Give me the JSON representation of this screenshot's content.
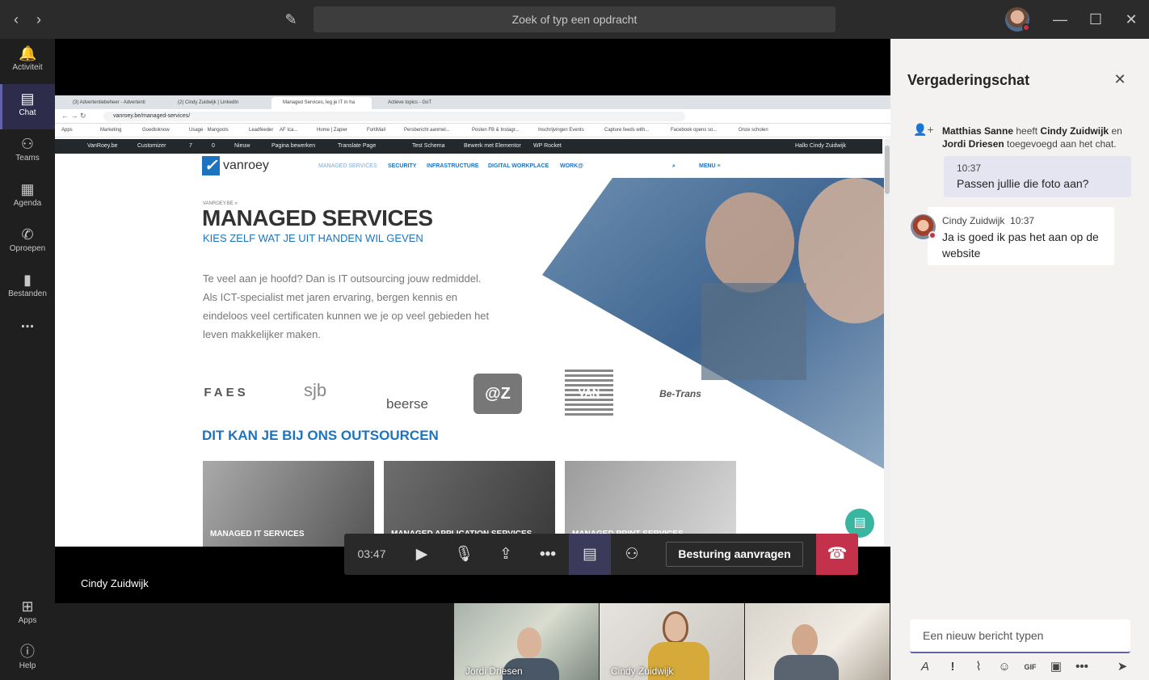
{
  "titlebar": {
    "search_placeholder": "Zoek of typ een opdracht"
  },
  "rail": {
    "items": [
      {
        "label": "Activiteit"
      },
      {
        "label": "Chat"
      },
      {
        "label": "Teams"
      },
      {
        "label": "Agenda"
      },
      {
        "label": "Oproepen"
      },
      {
        "label": "Bestanden"
      },
      {
        "label": "..."
      },
      {
        "label": "Apps"
      },
      {
        "label": "Help"
      }
    ]
  },
  "stage": {
    "presenter_name": "Cindy Zuidwijk",
    "browser": {
      "tabs": [
        "(3) Advertentiebeheer - Advertenti",
        "(2) Cindy Zuidwijk | LinkedIn",
        "Managed Services, leg je IT in ha",
        "Actieve topics - GoT"
      ],
      "url": "vanroey.be/managed-services/",
      "bookmarks": [
        "Apps",
        "Marketing",
        "Goedtoknow",
        "Usage · Mangools",
        "Leadfeeder",
        "AF Ica...",
        "Home | Zapier",
        "FortiMail",
        "Persbericht aanmel...",
        "Posten FB & Instagr...",
        "Inschrijvingen Events",
        "Capture feeds with...",
        "Facebook opens so...",
        "Onze scholen"
      ],
      "wpbar": [
        "VanRoey.be",
        "Customizer",
        "7",
        "0",
        "Nieuw",
        "Pagina bewerken",
        "Translate Page",
        "Test Schema",
        "Bewerk met Elementor",
        "WP Rocket",
        "Hallo Cindy Zuidwijk"
      ]
    },
    "site": {
      "logo": "vanroey",
      "nav": [
        "MANAGED SERVICES",
        "SECURITY",
        "INFRASTRUCTURE",
        "DIGITAL WORKPLACE",
        "WORK@",
        "MENU ≡"
      ],
      "breadcrumb": "VANROEY.BE »",
      "title": "MANAGED SERVICES",
      "subtitle": "KIES ZELF WAT JE UIT HANDEN WIL GEVEN",
      "intro": "Te veel aan je hoofd? Dan is IT outsourcing jouw redmiddel. Als ICT-specialist met jaren ervaring, bergen kennis en eindeloos veel certificaten kunnen we je op veel gebieden het leven makkelijker maken.",
      "clients": [
        "FAES",
        "sjb",
        "beerse",
        "@Z",
        "VAN ROEY",
        "Be-Trans"
      ],
      "section_title": "DIT KAN JE BIJ ONS OUTSOURCEN",
      "cards": [
        "MANAGED IT SERVICES",
        "MANAGED APPLICATION SERVICES",
        "MANAGED PRINT SERVICES"
      ]
    }
  },
  "controls": {
    "timer": "03:47",
    "request_control": "Besturing aanvragen"
  },
  "participants": [
    {
      "name": "Jordi Driesen"
    },
    {
      "name": "Cindy Zuidwijk"
    },
    {
      "name": ""
    }
  ],
  "chat": {
    "title": "Vergaderingschat",
    "system_message": {
      "actor": "Matthias Sanne",
      "verb1": "heeft",
      "target1": "Cindy Zuidwijk",
      "conj": "en",
      "target2": "Jordi Driesen",
      "rest": "toegevoegd aan het chat."
    },
    "messages": [
      {
        "from": "me",
        "time": "10:37",
        "text": "Passen jullie die foto aan?"
      },
      {
        "from": "Cindy Zuidwijk",
        "time": "10:37",
        "text": "Ja is goed ik pas het aan op de website"
      }
    ],
    "compose_placeholder": "Een nieuw bericht typen"
  },
  "colors": {
    "accent": "#6264a7",
    "hangup": "#c4314b",
    "brand_blue": "#1e73be"
  }
}
